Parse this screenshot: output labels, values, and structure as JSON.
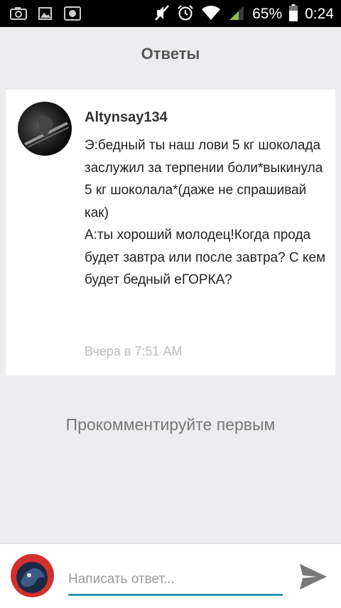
{
  "status_bar": {
    "icons_left": [
      "camera-icon",
      "gallery-icon",
      "screenshot-icon"
    ],
    "icons_right": [
      "mute-icon",
      "alarm-icon",
      "wifi-icon",
      "signal-icon"
    ],
    "battery_percent": "65%",
    "time": "0:24"
  },
  "header": {
    "title": "Ответы"
  },
  "comment": {
    "username": "Altynsay134",
    "text": "Э:бедный ты наш лови 5 кг шоколада заслужил за терпении боли*выкинула 5 кг шоколала*(даже не спрашивай как)\nА:ты хороший молодец!Когда прода будет завтра или после завтра? С кем будет бедный еГОРКА?",
    "timestamp": "Вчера в 7:51 AM"
  },
  "empty_state": {
    "text": "Прокомментируйте первым"
  },
  "reply": {
    "placeholder": "Написать ответ...",
    "value": ""
  },
  "colors": {
    "accent": "#2a98b5",
    "background": "#edecef",
    "avatar_bg": "#d32f2f"
  }
}
